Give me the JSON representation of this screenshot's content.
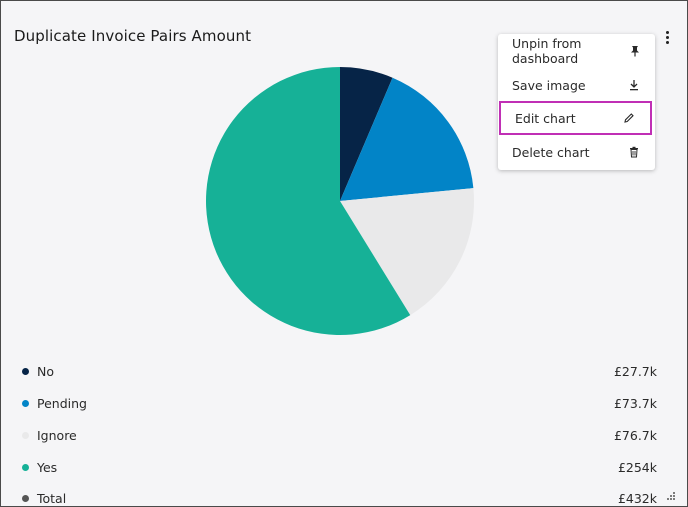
{
  "card": {
    "title": "Duplicate Invoice Pairs Amount"
  },
  "menu": {
    "items": [
      {
        "label": "Unpin from dashboard",
        "icon": "pin-icon"
      },
      {
        "label": "Save image",
        "icon": "download-icon"
      },
      {
        "label": "Edit chart",
        "icon": "pencil-icon",
        "highlighted": true
      },
      {
        "label": "Delete chart",
        "icon": "trash-icon"
      }
    ]
  },
  "legend": [
    {
      "label": "No",
      "value": "£27.7k",
      "color": "#062447"
    },
    {
      "label": "Pending",
      "value": "£73.7k",
      "color": "#0284c7"
    },
    {
      "label": "Ignore",
      "value": "£76.7k",
      "color": "#e9e9ea"
    },
    {
      "label": "Yes",
      "value": "£254k",
      "color": "#16b197"
    },
    {
      "label": "Total",
      "value": "£432k",
      "color": "#555555"
    }
  ],
  "chart_data": {
    "type": "pie",
    "categories": [
      "No",
      "Pending",
      "Ignore",
      "Yes"
    ],
    "values": [
      27.7,
      73.7,
      76.7,
      254
    ],
    "colors": [
      "#062447",
      "#0284c7",
      "#e9e9ea",
      "#16b197"
    ],
    "title": "Duplicate Invoice Pairs Amount"
  }
}
